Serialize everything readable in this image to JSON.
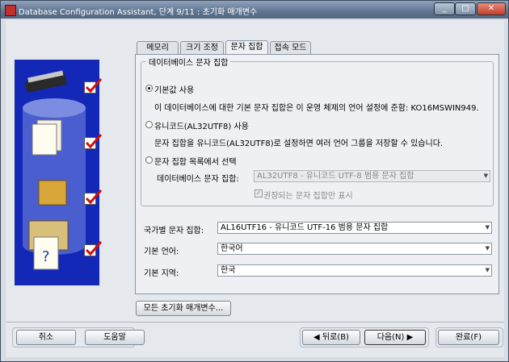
{
  "window": {
    "title": "Database Configuration Assistant, 단계 9/11 : 초기화 매개변수",
    "controls": [
      "_",
      "□",
      "✕"
    ]
  },
  "tabs": [
    {
      "label": "메모리",
      "selected": false
    },
    {
      "label": "크기 조정",
      "selected": false
    },
    {
      "label": "문자 집합",
      "selected": true
    },
    {
      "label": "접속 모드",
      "selected": false
    }
  ],
  "charset_group": {
    "legend": "데이터베이스 문자 집합",
    "option_default": {
      "label": "기본값 사용",
      "selected": true
    },
    "default_desc": "이 데이터베이스에 대한 기본 문자 집합은 이 운영 체제의 언어 설정에 준함: KO16MSWIN949.",
    "option_unicode": {
      "label": "유니코드(AL32UTF8) 사용",
      "selected": false
    },
    "unicode_desc": "문자 집합을 유니코드(AL32UTF8)로 설정하면 여러 언어 그룹을 저장할 수 있습니다.",
    "option_list": {
      "label": "문자 집합 목록에서 선택",
      "selected": false
    },
    "db_charset_label": "데이터베이스 문자 집합:",
    "db_charset_value": "AL32UTF8 - 유니코드 UTF-8 범용 문자 집합",
    "recommended_only_label": "권장되는 문자 집합만 표시",
    "recommended_only_checked": true
  },
  "national_charset": {
    "label": "국가별 문자 집합:",
    "value": "AL16UTF16 - 유니코드 UTF-16 범용 문자 집합"
  },
  "default_language": {
    "label": "기본 언어:",
    "value": "한국어"
  },
  "default_territory": {
    "label": "기본 지역:",
    "value": "한국"
  },
  "all_params_button": "모든 초기화 매개변수...",
  "buttons": {
    "cancel": "취소",
    "help": "도움말",
    "back": "뒤로(B)",
    "next": "다음(N)",
    "finish": "완료(F)"
  }
}
